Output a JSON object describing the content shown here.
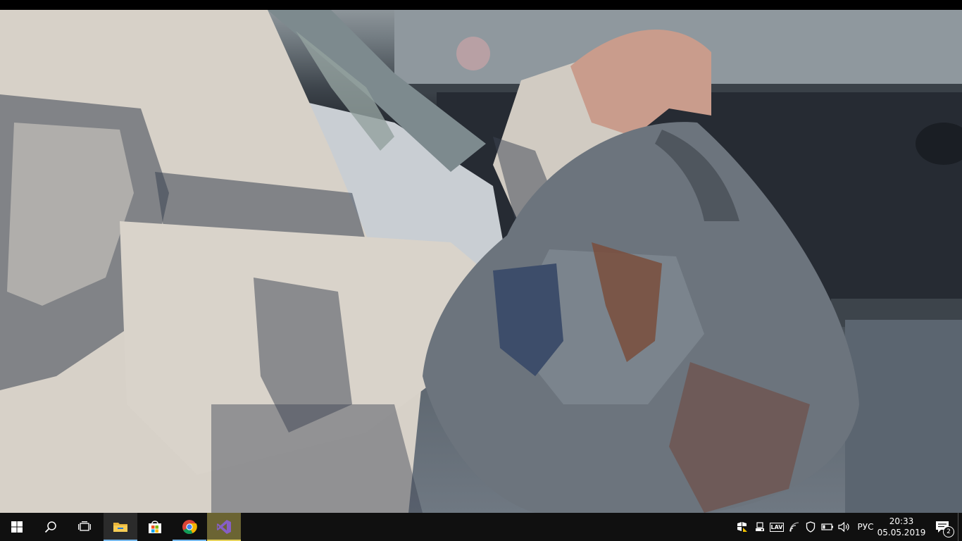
{
  "taskbar": {
    "apps": [
      {
        "name": "File Explorer",
        "icon": "folder-icon"
      },
      {
        "name": "Microsoft Store",
        "icon": "store-icon"
      },
      {
        "name": "Google Chrome",
        "icon": "chrome-icon"
      },
      {
        "name": "Visual Studio",
        "icon": "visual-studio-icon"
      }
    ],
    "tray": {
      "language": "РУС",
      "time": "20:33",
      "date": "05.05.2019",
      "notification_count": "2",
      "antivirus_label": "LAV"
    }
  },
  "colors": {
    "taskbar_bg": "#101010",
    "active_underline": "#76b9ed",
    "vs_highlight": "#e6d25a"
  }
}
